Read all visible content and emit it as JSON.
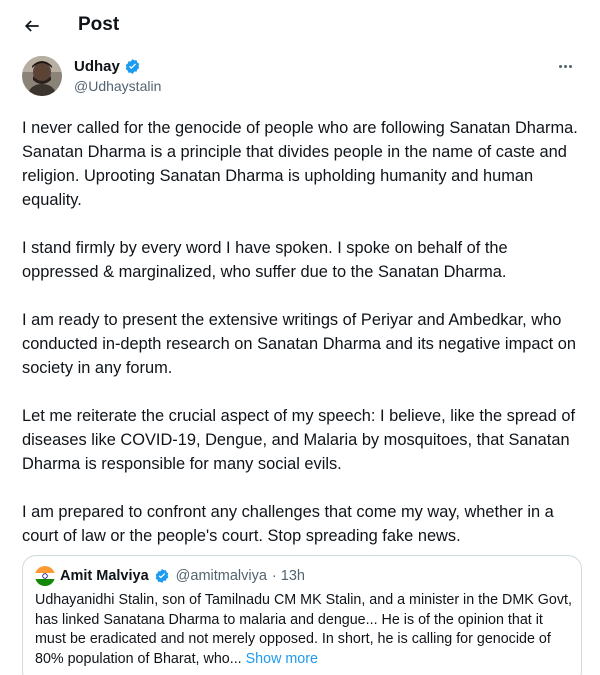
{
  "header": {
    "title": "Post"
  },
  "author": {
    "name": "Udhay",
    "handle": "@Udhaystalin"
  },
  "tweet": {
    "paragraphs": [
      "I never called for the genocide of people who are following Sanatan Dharma. Sanatan Dharma is a principle that divides people in the name of caste and religion. Uprooting Sanatan Dharma is upholding humanity and human equality.",
      "I stand firmly by every word I have spoken. I spoke on behalf of the oppressed & marginalized, who suffer due to the Sanatan Dharma.",
      "I am ready to present the extensive writings of Periyar and Ambedkar, who conducted in-depth research on Sanatan Dharma and its negative impact on society in any forum.",
      "Let me reiterate the crucial aspect of my speech: I believe, like the spread of diseases like COVID-19, Dengue, and Malaria by mosquitoes, that Sanatan Dharma is responsible for many social evils.",
      "I am prepared to confront any challenges that come my way, whether in a court of law or the people's court. Stop spreading fake news."
    ]
  },
  "quote": {
    "name": "Amit Malviya",
    "handle": "@amitmalviya",
    "time": "· 13h",
    "text": "Udhayanidhi Stalin, son of Tamilnadu CM MK Stalin, and a minister in the DMK Govt, has linked Sanatana Dharma to malaria and dengue... He is of the opinion that it must be eradicated and not merely opposed. In short, he is calling for genocide of 80% population of Bharat, who...",
    "show_more": "Show more"
  },
  "colors": {
    "verified": "#1d9bf0",
    "link": "#1d9bf0",
    "secondary_text": "#536471",
    "border": "#cfd9de"
  },
  "icons": {
    "back": "arrow-left-icon",
    "verified": "verified-badge-icon",
    "more": "more-horizontal-icon"
  }
}
